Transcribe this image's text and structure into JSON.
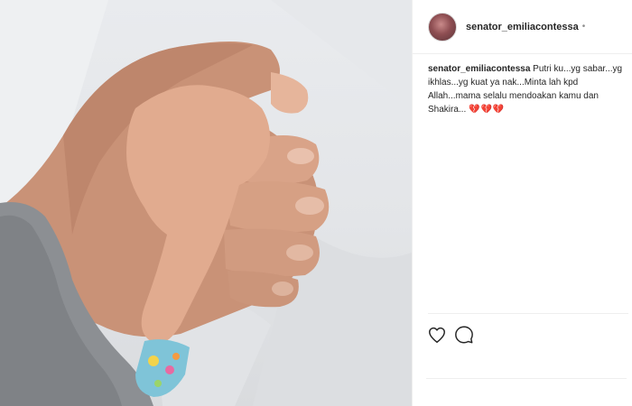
{
  "post": {
    "username": "senator_emiliacontessa",
    "dot": "•",
    "caption": {
      "username": "senator_emiliacontessa",
      "text": "Putri ku...yg sabar...yg ikhlas...yg kuat ya nak...Minta lah kpd Allah...mama selalu mendoakan kamu dan Shakira...",
      "emoji": "💔💔💔"
    }
  },
  "icons": {
    "like": "heart-icon",
    "comment": "comment-icon"
  },
  "colors": {
    "text": "#262626",
    "muted": "#8e8e8e",
    "divider": "#efefef",
    "heart_emoji": "#d32f3f"
  }
}
